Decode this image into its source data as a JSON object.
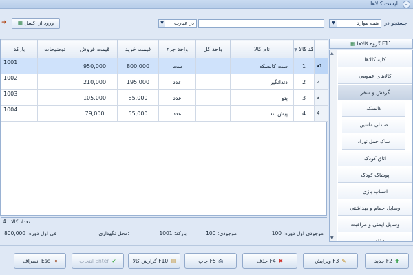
{
  "window": {
    "title": "لیست کالاها"
  },
  "toolbar": {
    "search_label": "جستجو در",
    "scope_value": "همه موارد",
    "in_phrase_label": "در عبارت",
    "phrase_value": "",
    "excel_button": "ورود از اکسل"
  },
  "grid": {
    "columns": [
      "بارکد",
      "توضیحات",
      "قیمت فروش",
      "قیمت خرید",
      "واحد جزء",
      "واحد کل",
      "نام کالا",
      "کد کالا"
    ],
    "rows": [
      {
        "barcode": "1001",
        "desc": "",
        "sell": "950,000",
        "buy": "800,000",
        "unit_part": "ست",
        "unit_total": "",
        "name": "ست کالسکه",
        "code": "1",
        "marker": "1"
      },
      {
        "barcode": "1002",
        "desc": "",
        "sell": "210,000",
        "buy": "195,000",
        "unit_part": "عدد",
        "unit_total": "",
        "name": "دندانگیر",
        "code": "2",
        "marker": "2"
      },
      {
        "barcode": "1003",
        "desc": "",
        "sell": "105,000",
        "buy": "85,000",
        "unit_part": "عدد",
        "unit_total": "",
        "name": "پتو",
        "code": "3",
        "marker": "3"
      },
      {
        "barcode": "1004",
        "desc": "",
        "sell": "79,000",
        "buy": "55,000",
        "unit_part": "عدد",
        "unit_total": "",
        "name": "پیش بند",
        "code": "4",
        "marker": "4"
      }
    ],
    "count_text": "تعداد کالا : 4"
  },
  "info": {
    "first_stock": "موجودی اول دوره: 100",
    "stock": "موجودی: 100",
    "barcode": "بارکد: 1001",
    "location": "محل نگهداری:",
    "first_price": "فی اول دوره: 800,000"
  },
  "sidebar": {
    "header": "گروه کالاها F11",
    "items": [
      {
        "label": "کلیه کالاها",
        "selected": false,
        "sub": false
      },
      {
        "label": "کالاهای عمومی",
        "selected": false,
        "sub": false
      },
      {
        "label": "گردش و سفر",
        "selected": true,
        "sub": false
      },
      {
        "label": "کالسکه",
        "selected": false,
        "sub": true
      },
      {
        "label": "صندلی ماشین",
        "selected": false,
        "sub": true
      },
      {
        "label": "ساک حمل نوزاد",
        "selected": false,
        "sub": true
      },
      {
        "label": "اتاق کودک",
        "selected": false,
        "sub": false
      },
      {
        "label": "پوشاک کودک",
        "selected": false,
        "sub": false
      },
      {
        "label": "اسباب بازی",
        "selected": false,
        "sub": false
      },
      {
        "label": "وسایل حمام و بهداشتی",
        "selected": false,
        "sub": false
      },
      {
        "label": "وسایل ایمنی و مراقبت",
        "selected": false,
        "sub": false
      },
      {
        "label": "غذاخوری",
        "selected": false,
        "sub": false
      }
    ]
  },
  "buttons": {
    "new": "جدید F2",
    "edit": "ویرایش F3",
    "delete": "حذف F4",
    "print": "چاپ F5",
    "report": "گزارش کالا F10",
    "select": "انتخاب Enter",
    "cancel": "انصراف Esc"
  },
  "colors": {
    "selection": "#cfe2fb",
    "accent": "#3a5f91",
    "background": "#dfe8f5"
  }
}
